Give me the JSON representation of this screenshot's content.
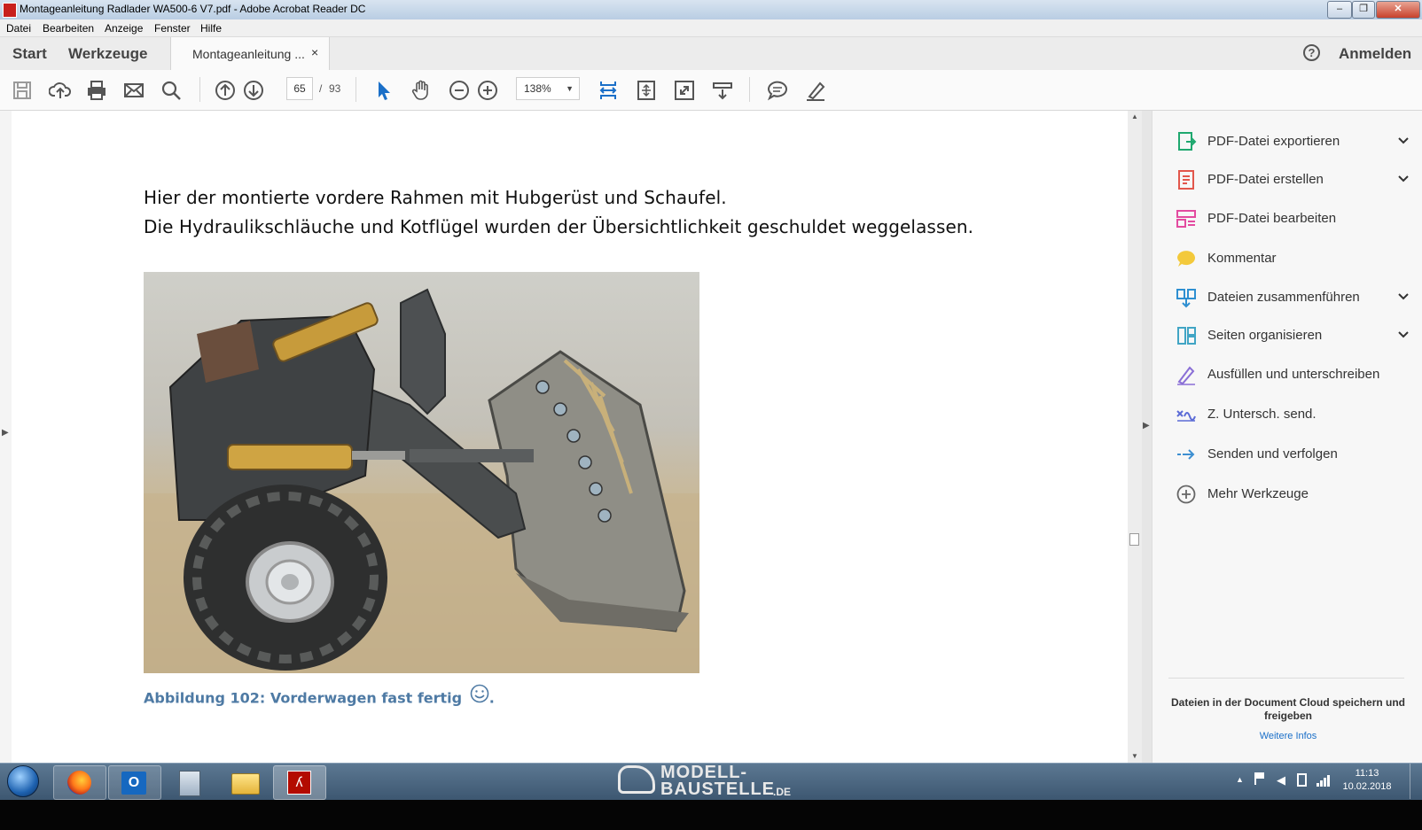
{
  "window": {
    "title": "Montageanleitung Radlader WA500-6 V7.pdf - Adobe Acrobat Reader DC",
    "minimize": "–",
    "maximize": "❐",
    "close": "✕"
  },
  "menu": [
    "Datei",
    "Bearbeiten",
    "Anzeige",
    "Fenster",
    "Hilfe"
  ],
  "tabs": {
    "start": "Start",
    "tools": "Werkzeuge",
    "document": "Montageanleitung ...",
    "close_tab": "×",
    "help_icon": "?",
    "signin": "Anmelden"
  },
  "toolbar": {
    "current_page": "65",
    "page_separator": "/",
    "total_pages": "93",
    "zoom": "138%"
  },
  "document": {
    "line1": "Hier der montierte vordere Rahmen mit Hubgerüst und Schaufel.",
    "line2": "Die Hydraulikschläuche und Kotflügel wurden der Übersichtlichkeit geschuldet weggelassen.",
    "caption": "Abbildung 102: Vorderwagen fast fertig",
    "caption_end": "."
  },
  "tools_pane": {
    "items": [
      {
        "label": "PDF-Datei exportieren",
        "icon": "export-pdf-icon",
        "color": "#1fa86f",
        "expandable": true
      },
      {
        "label": "PDF-Datei erstellen",
        "icon": "create-pdf-icon",
        "color": "#e2574c",
        "expandable": true
      },
      {
        "label": "PDF-Datei bearbeiten",
        "icon": "edit-pdf-icon",
        "color": "#e34ba0",
        "expandable": false
      },
      {
        "label": "Kommentar",
        "icon": "comment-icon",
        "color": "#f3c93b",
        "expandable": false
      },
      {
        "label": "Dateien zusammenführen",
        "icon": "combine-files-icon",
        "color": "#2e8fd1",
        "expandable": true
      },
      {
        "label": "Seiten organisieren",
        "icon": "organize-pages-icon",
        "color": "#41a5c5",
        "expandable": true
      },
      {
        "label": "Ausfüllen und unterschreiben",
        "icon": "fill-sign-icon",
        "color": "#8a6fd6",
        "expandable": false
      },
      {
        "label": "Z. Untersch. send.",
        "icon": "send-signature-icon",
        "color": "#5b6bd6",
        "expandable": false
      },
      {
        "label": "Senden und verfolgen",
        "icon": "send-track-icon",
        "color": "#3d8fd1",
        "expandable": false
      },
      {
        "label": "Mehr Werkzeuge",
        "icon": "more-tools-icon",
        "color": "#666666",
        "expandable": false
      }
    ],
    "cloud_text": "Dateien in der Document Cloud speichern und freigeben",
    "cloud_link": "Weitere Infos"
  },
  "taskbar": {
    "watermark_line1": "MODELL-",
    "watermark_line2": "BAUSTELLE",
    "watermark_suffix": ".DE",
    "time": "11:13",
    "date": "10.02.2018"
  }
}
